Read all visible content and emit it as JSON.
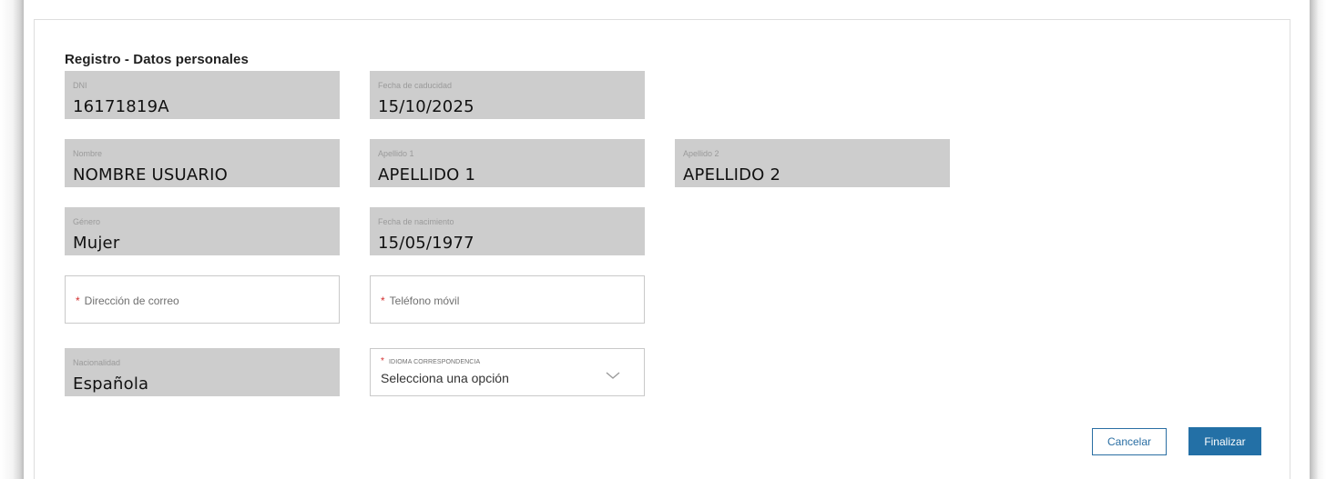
{
  "form": {
    "title": "Registro - Datos personales",
    "dni": {
      "label": "DNI",
      "value": "16171819A"
    },
    "fecha_caducidad": {
      "label": "Fecha de caducidad",
      "value": "15/10/2025"
    },
    "nombre": {
      "label": "Nombre",
      "value": "NOMBRE USUARIO"
    },
    "apellido1": {
      "label": "Apellido 1",
      "value": "APELLIDO 1"
    },
    "apellido2": {
      "label": "Apellido 2",
      "value": "APELLIDO 2"
    },
    "genero": {
      "label": "Género",
      "value": "Mujer"
    },
    "fecha_nacimiento": {
      "label": "Fecha de nacimiento",
      "value": "15/05/1977"
    },
    "correo": {
      "required_mark": "*",
      "placeholder": "Dirección de correo",
      "value": ""
    },
    "telefono": {
      "required_mark": "*",
      "placeholder": "Teléfono móvil",
      "value": ""
    },
    "nacionalidad": {
      "label": "Nacionalidad",
      "value": "Española"
    },
    "idioma": {
      "required_mark": "*",
      "label": "IDIOMA CORRESPONDENCIA",
      "selected": "Selecciona una opción",
      "icon": "chevron-down-icon"
    }
  },
  "actions": {
    "cancel_label": "Cancelar",
    "finish_label": "Finalizar"
  },
  "colors": {
    "readonly_bg": "#cdcdcd",
    "required": "#d32f2f",
    "primary": "#2370a6"
  }
}
